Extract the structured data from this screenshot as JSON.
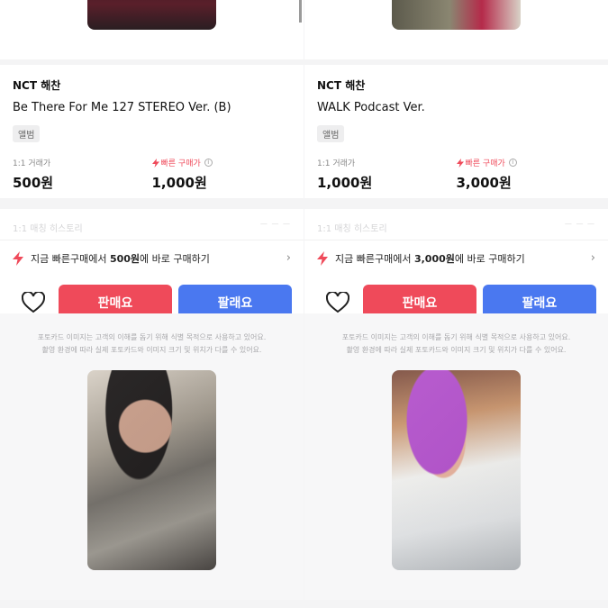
{
  "listings": [
    {
      "artist": "NCT 해찬",
      "title": "Be There For Me 127 STEREO Ver. (B)",
      "category": "앨범",
      "trade_label": "1:1 거래가",
      "trade_price": "500원",
      "fast_label": "빠른 구매가",
      "fast_price": "1,000원",
      "history_label": "1:1 매칭 히스토리",
      "banner": {
        "prefix": "지금 빠른구매에서 ",
        "amount": "500원",
        "suffix": "에 바로 구매하기"
      },
      "sell_label": "판매요",
      "buy_label": "팔래요"
    },
    {
      "artist": "NCT 해찬",
      "title": "WALK Podcast Ver.",
      "category": "앨범",
      "trade_label": "1:1 거래가",
      "trade_price": "1,000원",
      "fast_label": "빠른 구매가",
      "fast_price": "3,000원",
      "history_label": "1:1 매칭 히스토리",
      "banner": {
        "prefix": "지금 빠른구매에서 ",
        "amount": "3,000원",
        "suffix": "에 바로 구매하기"
      },
      "sell_label": "판매요",
      "buy_label": "팔래요"
    }
  ],
  "disclaimer": {
    "line1": "포토카드 이미지는 고객의 이해를 돕기 위해 식별 목적으로 사용하고 있어요.",
    "line2": "촬영 환경에 따라 실제 포토카드와 이미지 크기 및 위치가 다를 수 있어요."
  },
  "colors": {
    "accent_red": "#ef4a5a",
    "accent_blue": "#4a78f0"
  },
  "icons": {
    "heart": "heart-icon",
    "bolt": "lightning-icon",
    "chevron": "chevron-right-icon",
    "info": "info-icon"
  }
}
